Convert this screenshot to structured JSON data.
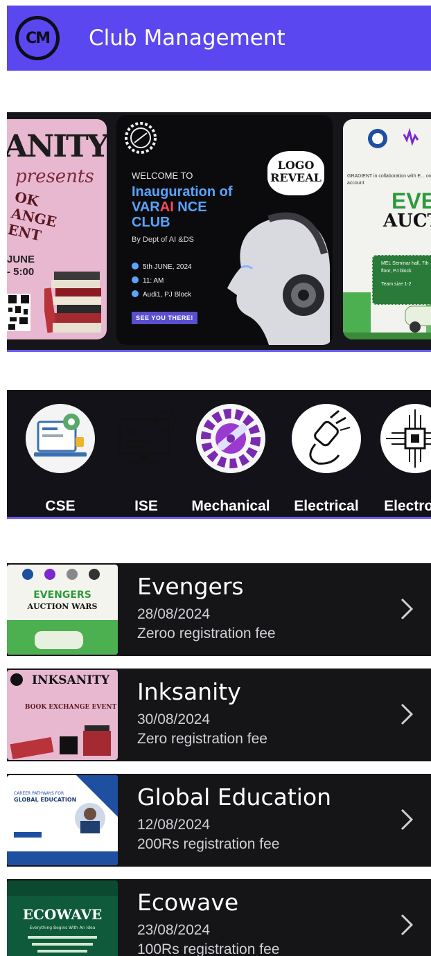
{
  "appbar": {
    "logo_text": "CM",
    "title": "Club Management",
    "color": "#5b47ef"
  },
  "carousel": {
    "left": {
      "brand": "ANITY",
      "presents": "presents",
      "book_lines": "OK\nANGE\nENT",
      "date_lines": "JUNE\n- 5:00"
    },
    "center": {
      "welcome": "WELCOME TO",
      "title_line1": "Inauguration of",
      "title_var": "VAR",
      "title_ai": "AI",
      "title_nce": " NCE",
      "title_line3": "CLUB",
      "by": "By Dept of AI &DS",
      "date": "5th JUNE, 2024",
      "time": "11: AM",
      "venue": "Audi1, PJ Block",
      "button": "SEE YOU THERE!",
      "reveal": "LOGO\nREVEAL"
    },
    "right": {
      "gradient": "GRADIENT in collaboration with E... on account",
      "ev": "EVE",
      "auction": "AUCTI",
      "venue": "MEL Seminar hall, 7th floor, PJ block",
      "team": "Team size 1-2"
    }
  },
  "departments": [
    {
      "label": "CSE",
      "icon": "laptop-gear-icon"
    },
    {
      "label": "ISE",
      "icon": "monitor-code-icon"
    },
    {
      "label": "Mechanical",
      "icon": "gear-wrench-icon"
    },
    {
      "label": "Electrical",
      "icon": "plug-icon"
    },
    {
      "label": "Electroni",
      "icon": "circuit-chip-icon"
    }
  ],
  "events": [
    {
      "name": "Evengers",
      "date": "28/08/2024",
      "fee": "Zeroo registration fee",
      "thumb_title": "EVENGERS",
      "thumb_sub": "AUCTION WARS"
    },
    {
      "name": "Inksanity",
      "date": "30/08/2024",
      "fee": "Zero registration fee",
      "thumb_title": "INKSANITY",
      "thumb_sub": "BOOK EXCHANGE EVENT"
    },
    {
      "name": "Global Education",
      "date": "12/08/2024",
      "fee": "200Rs registration fee",
      "thumb_title": "GLOBAL EDUCATION",
      "thumb_sub": "CAREER PATHWAYS FOR"
    },
    {
      "name": "Ecowave",
      "date": "23/08/2024",
      "fee": "100Rs registration fee",
      "thumb_title": "ECOWAVE",
      "thumb_sub": "Everything Begins With An Idea"
    }
  ]
}
